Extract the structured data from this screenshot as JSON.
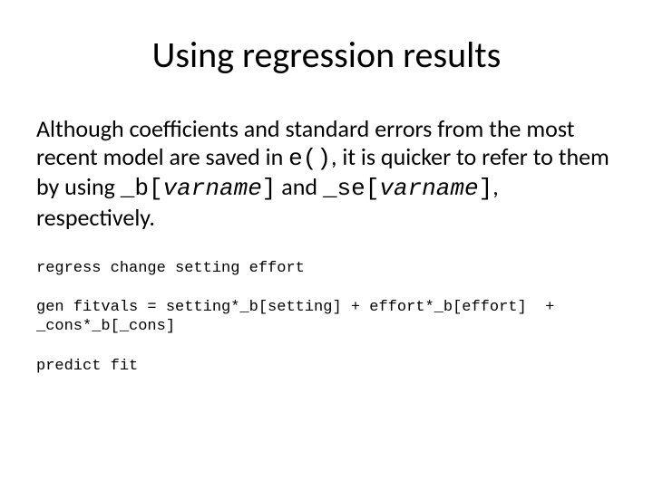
{
  "title": "Using regression results",
  "body": {
    "seg1": "Although coefficients and standard errors from the most recent model are saved in ",
    "code1": "e()",
    "seg2": ", it is quicker to refer to them by using ",
    "code2a": "_b[",
    "code2b": "varname",
    "code2c": "]",
    "seg3": " and ",
    "code3a": "_se[",
    "code3b": "varname",
    "code3c": "]",
    "seg4": ", respectively."
  },
  "code_lines": {
    "l1": "regress change setting effort",
    "l2": "gen fitvals = setting*_b[setting] + effort*_b[effort]  + _cons*_b[_cons]",
    "l3": "predict fit"
  }
}
